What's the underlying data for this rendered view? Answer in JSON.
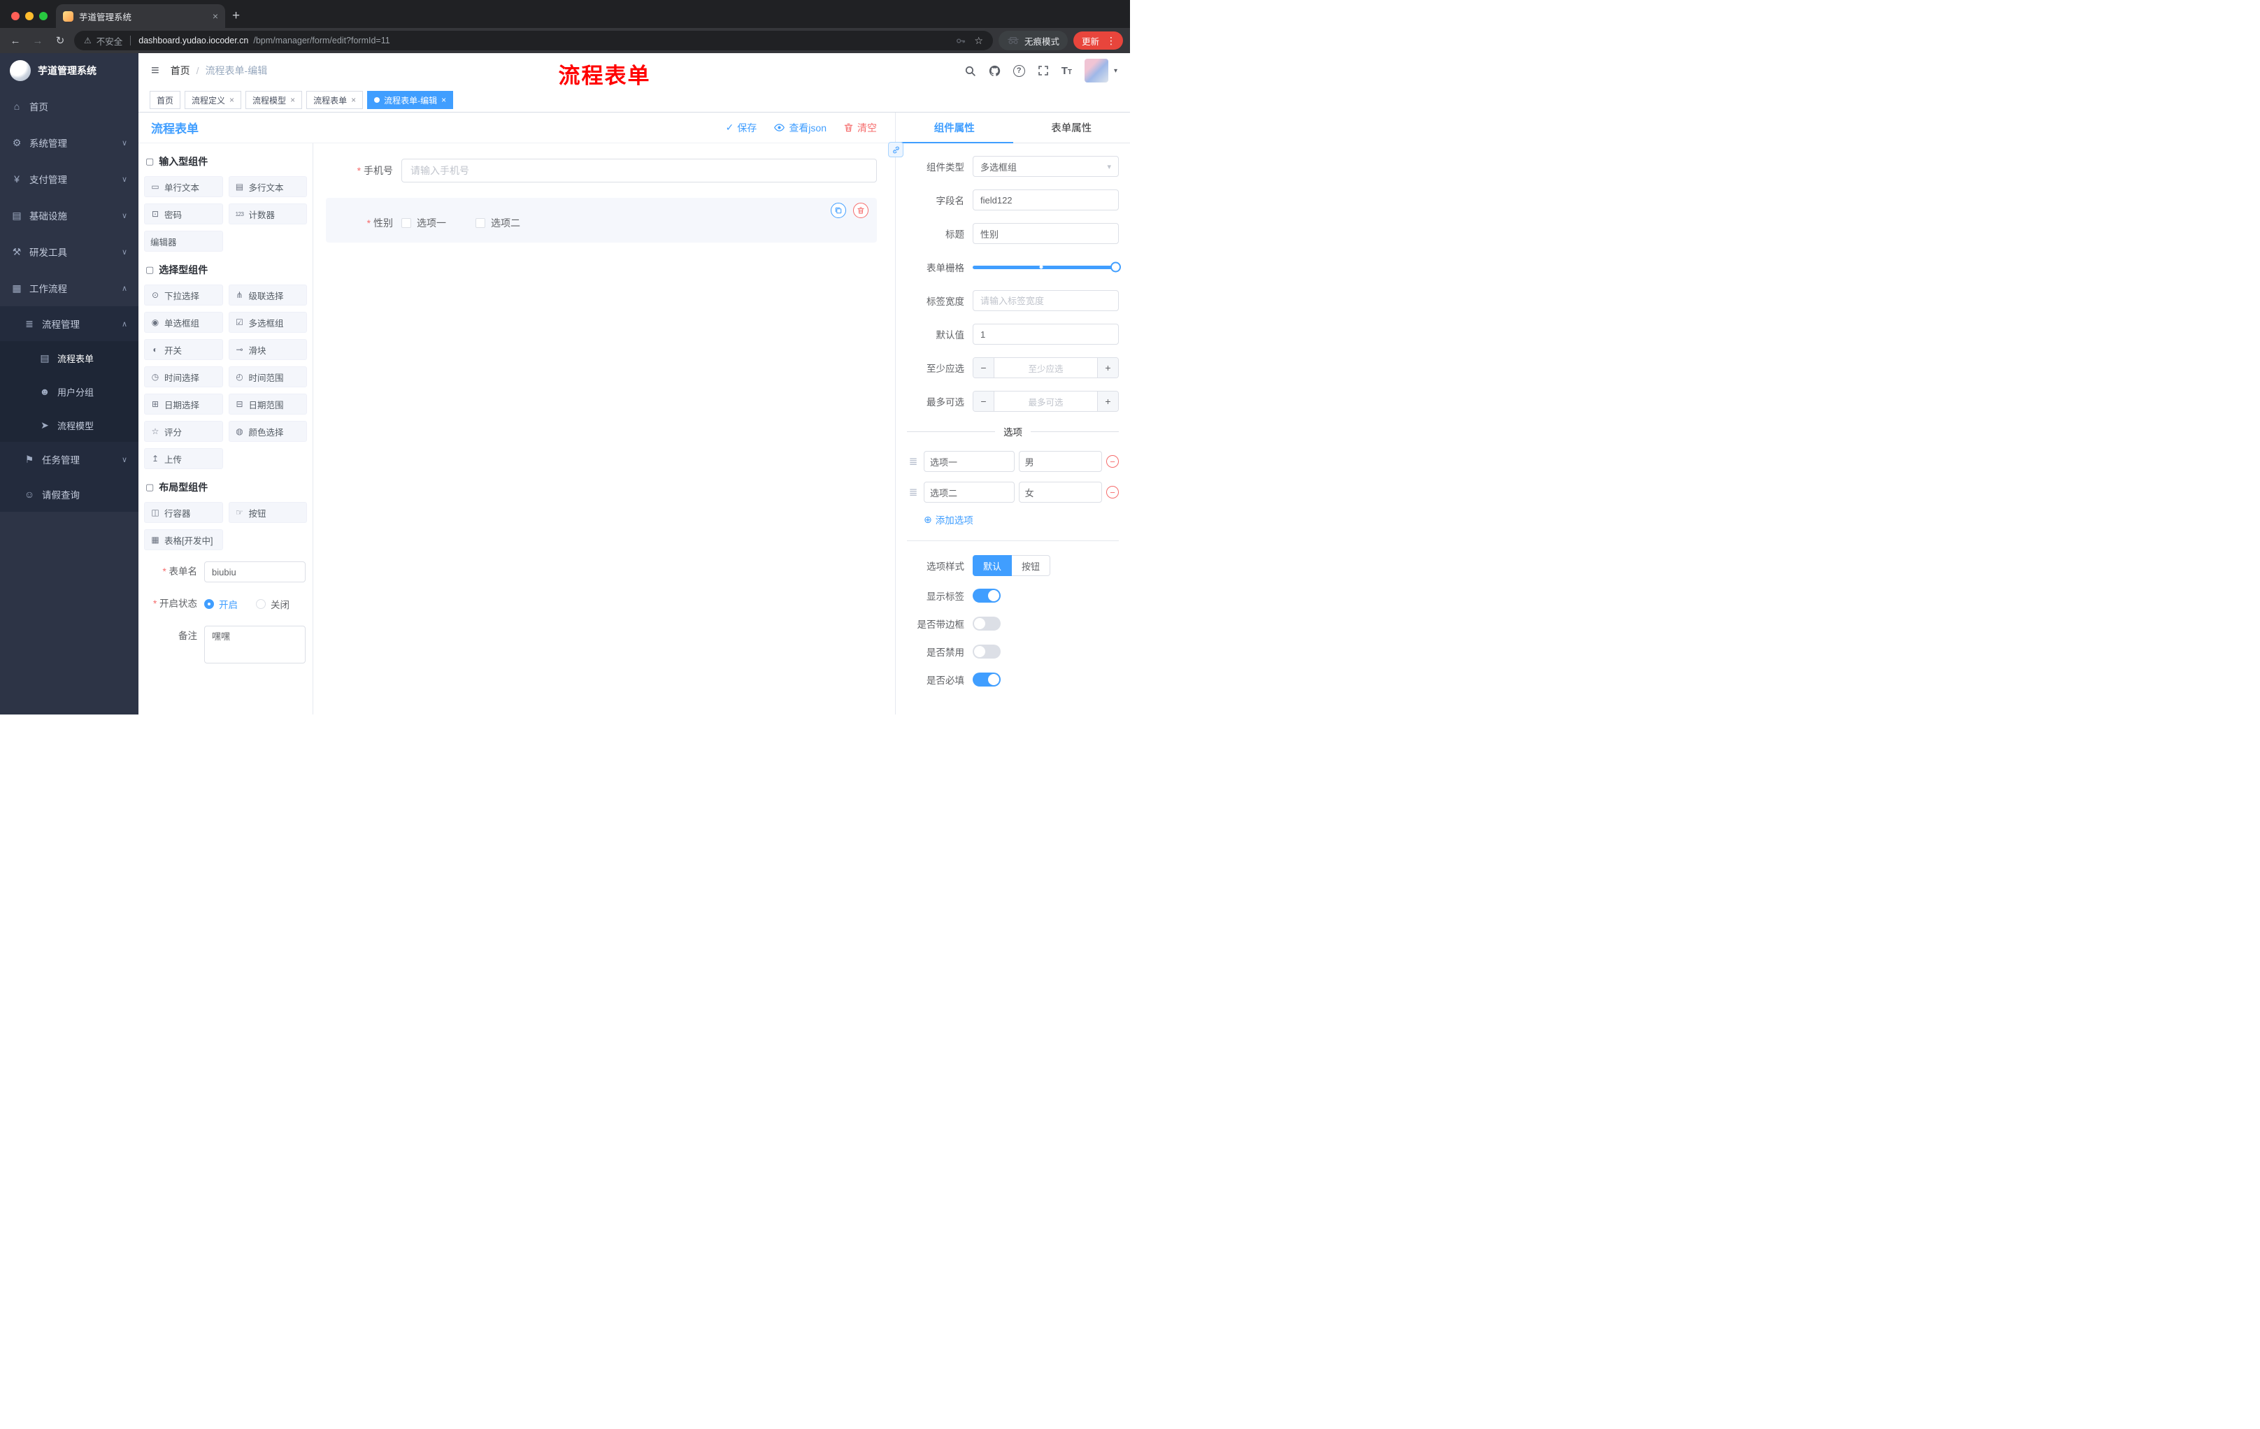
{
  "colors": {
    "accent": "#409eff",
    "danger": "#f56c6c",
    "annotation": "#ff0000",
    "sidebar_bg": "#2d3446",
    "active_tab_bg": "#409eff"
  },
  "browser": {
    "tab_title": "芋道管理系统",
    "security_label": "不安全",
    "url_domain": "dashboard.yudao.iocoder.cn",
    "url_path": "/bpm/manager/form/edit?formId=11",
    "incognito_label": "无痕模式",
    "update_label": "更新"
  },
  "sidebar": {
    "logo_title": "芋道管理系统",
    "items": [
      {
        "id": "home",
        "label": "首页",
        "icon": "home-icon",
        "level": 1
      },
      {
        "id": "system",
        "label": "系统管理",
        "icon": "gear-icon",
        "level": 1,
        "chevron": "down"
      },
      {
        "id": "payment",
        "label": "支付管理",
        "icon": "yen-icon",
        "level": 1,
        "chevron": "down"
      },
      {
        "id": "infrastructure",
        "label": "基础设施",
        "icon": "infrastructure-icon",
        "level": 1,
        "chevron": "down"
      },
      {
        "id": "devtools",
        "label": "研发工具",
        "icon": "tools-icon",
        "level": 1,
        "chevron": "down"
      },
      {
        "id": "workflow",
        "label": "工作流程",
        "icon": "workflow-icon",
        "level": 1,
        "chevron": "up"
      },
      {
        "id": "process-management",
        "label": "流程管理",
        "icon": "process-management-icon",
        "level": 2,
        "chevron": "up"
      },
      {
        "id": "process-form",
        "label": "流程表单",
        "icon": "form-icon",
        "level": 3,
        "active": true
      },
      {
        "id": "user-group",
        "label": "用户分组",
        "icon": "user-group-icon",
        "level": 3
      },
      {
        "id": "process-model",
        "label": "流程模型",
        "icon": "send-icon",
        "level": 3
      },
      {
        "id": "task-management",
        "label": "任务管理",
        "icon": "task-icon",
        "level": 2,
        "chevron": "down"
      },
      {
        "id": "leave-query",
        "label": "请假查询",
        "icon": "person-icon",
        "level": 2
      }
    ]
  },
  "header": {
    "breadcrumb_home": "首页",
    "breadcrumb_current": "流程表单-编辑",
    "annotation": "流程表单"
  },
  "tabs": [
    {
      "label": "首页",
      "closable": false,
      "active": false
    },
    {
      "label": "流程定义",
      "closable": true,
      "active": false
    },
    {
      "label": "流程模型",
      "closable": true,
      "active": false
    },
    {
      "label": "流程表单",
      "closable": true,
      "active": false
    },
    {
      "label": "流程表单-编辑",
      "closable": true,
      "active": true
    }
  ],
  "toolbar": {
    "page_title": "流程表单",
    "save_label": "保存",
    "view_json_label": "查看json",
    "clear_label": "清空"
  },
  "palette": {
    "sections": [
      {
        "title": "输入型组件",
        "items": [
          {
            "id": "single-text",
            "label": "单行文本",
            "icon": "single-line-icon"
          },
          {
            "id": "multi-text",
            "label": "多行文本",
            "icon": "multi-line-icon"
          },
          {
            "id": "password",
            "label": "密码",
            "icon": "password-icon"
          },
          {
            "id": "counter",
            "label": "计数器",
            "icon": "counter-icon"
          },
          {
            "id": "editor",
            "label": "编辑器",
            "icon": null
          }
        ]
      },
      {
        "title": "选择型组件",
        "items": [
          {
            "id": "select",
            "label": "下拉选择",
            "icon": "select-icon"
          },
          {
            "id": "cascader",
            "label": "级联选择",
            "icon": "cascader-icon"
          },
          {
            "id": "radio-group",
            "label": "单选框组",
            "icon": "radio-group-icon"
          },
          {
            "id": "checkbox-group",
            "label": "多选框组",
            "icon": "checkbox-group-icon"
          },
          {
            "id": "switch",
            "label": "开关",
            "icon": "switch-icon"
          },
          {
            "id": "slider",
            "label": "滑块",
            "icon": "slider-icon"
          },
          {
            "id": "time",
            "label": "时间选择",
            "icon": "time-icon"
          },
          {
            "id": "time-range",
            "label": "时间范围",
            "icon": "time-range-icon"
          },
          {
            "id": "date",
            "label": "日期选择",
            "icon": "date-icon"
          },
          {
            "id": "date-range",
            "label": "日期范围",
            "icon": "date-range-icon"
          },
          {
            "id": "rate",
            "label": "评分",
            "icon": "rate-icon"
          },
          {
            "id": "color",
            "label": "颜色选择",
            "icon": "color-icon"
          },
          {
            "id": "upload",
            "label": "上传",
            "icon": "upload-icon"
          }
        ]
      },
      {
        "title": "布局型组件",
        "items": [
          {
            "id": "row",
            "label": "行容器",
            "icon": "row-icon"
          },
          {
            "id": "button",
            "label": "按钮",
            "icon": "button-icon"
          },
          {
            "id": "table",
            "label": "表格[开发中]",
            "icon": "table-icon"
          }
        ]
      }
    ]
  },
  "form_meta": {
    "name_label": "表单名",
    "name_value": "biubiu",
    "status_label": "开启状态",
    "status_options": [
      "开启",
      "关闭"
    ],
    "status_selected": "开启",
    "remark_label": "备注",
    "remark_value": "嘿嘿"
  },
  "canvas": {
    "fields": [
      {
        "label": "手机号",
        "required": true,
        "type": "input",
        "placeholder": "请输入手机号"
      },
      {
        "label": "性别",
        "required": true,
        "type": "checkbox-group",
        "options": [
          "选项一",
          "选项二"
        ],
        "selected": true
      }
    ]
  },
  "properties": {
    "tabs": [
      "组件属性",
      "表单属性"
    ],
    "active_tab": "组件属性",
    "component_type_label": "组件类型",
    "component_type_value": "多选框组",
    "field_name_label": "字段名",
    "field_name_value": "field122",
    "title_label": "标题",
    "title_value": "性别",
    "grid_label": "表单栅格",
    "label_width_label": "标签宽度",
    "label_width_placeholder": "请输入标签宽度",
    "default_label": "默认值",
    "default_value": "1",
    "min_label": "至少应选",
    "min_placeholder": "至少应选",
    "max_label": "最多可选",
    "max_placeholder": "最多可选",
    "options_divider": "选项",
    "options": [
      {
        "label": "选项一",
        "value": "男"
      },
      {
        "label": "选项二",
        "value": "女"
      }
    ],
    "add_option": "添加选项",
    "style_label": "选项样式",
    "style_options": [
      "默认",
      "按钮"
    ],
    "style_selected": "默认",
    "toggles": [
      {
        "id": "show-label",
        "label": "显示标签",
        "on": true
      },
      {
        "id": "border",
        "label": "是否带边框",
        "on": false
      },
      {
        "id": "disabled",
        "label": "是否禁用",
        "on": false
      },
      {
        "id": "required",
        "label": "是否必填",
        "on": true
      }
    ]
  }
}
